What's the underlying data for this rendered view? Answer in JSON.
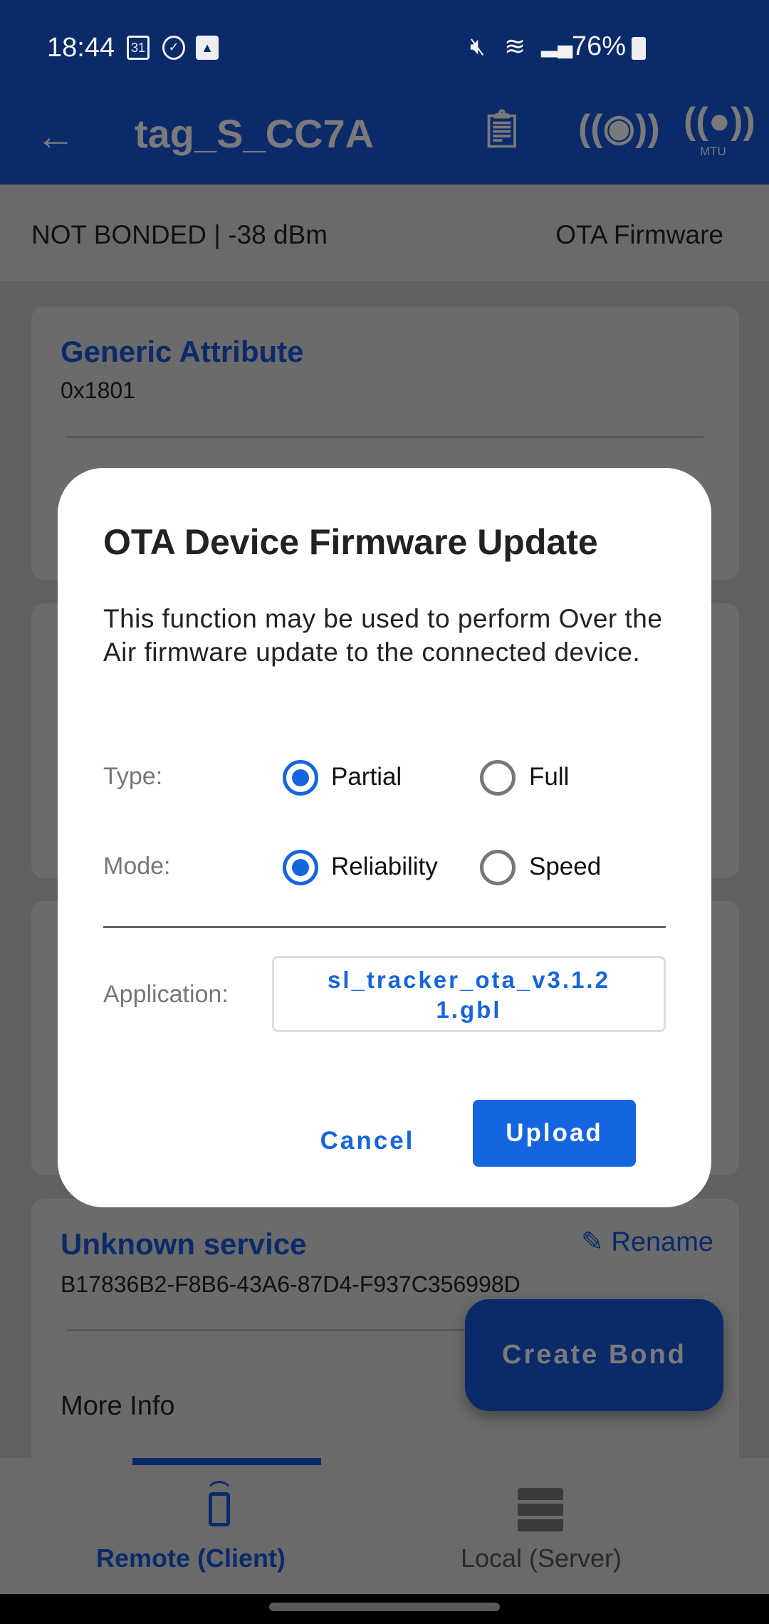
{
  "status_bar": {
    "time": "18:44",
    "calendar_day": "31",
    "battery": "76%",
    "battery_level": 0.76,
    "icons": [
      "calendar-icon",
      "check-circle-icon",
      "gallery-icon",
      "mute-icon",
      "wifi-icon",
      "signal-icon",
      "battery-icon"
    ]
  },
  "header": {
    "title": "tag_S_CC7A",
    "mtu_label": "MTU",
    "icons": [
      "back-arrow-icon",
      "log-clock-icon",
      "connection-priority-icon",
      "mtu-icon"
    ]
  },
  "info_bar": {
    "status": "NOT BONDED | -38 dBm",
    "ota_label": "OTA Firmware"
  },
  "services": [
    {
      "name": "Generic Attribute",
      "uuid": "0x1801"
    },
    {
      "name": "Unknown service",
      "uuid": "B17836B2-F8B6-43A6-87D4-F937C356998D",
      "rename_label": "Rename",
      "more_info": "More Info"
    }
  ],
  "fab": {
    "label": "Create Bond"
  },
  "bottom_nav": {
    "items": [
      {
        "label": "Remote (Client)",
        "active": true
      },
      {
        "label": "Local (Server)",
        "active": false
      }
    ]
  },
  "dialog": {
    "title": "OTA Device Firmware Update",
    "body": "This function may be used to perform Over the Air firmware update to the connected device.",
    "type_label": "Type:",
    "type_options": [
      "Partial",
      "Full"
    ],
    "type_selected": "Partial",
    "mode_label": "Mode:",
    "mode_options": [
      "Reliability",
      "Speed"
    ],
    "mode_selected": "Reliability",
    "application_label": "Application:",
    "application_file_line1": "sl_tracker_ota_v3.1.2",
    "application_file_line2": "1.gbl",
    "cancel_label": "Cancel",
    "upload_label": "Upload"
  },
  "colors": {
    "brand": "#0b2a6a",
    "accent": "#1565e0"
  }
}
